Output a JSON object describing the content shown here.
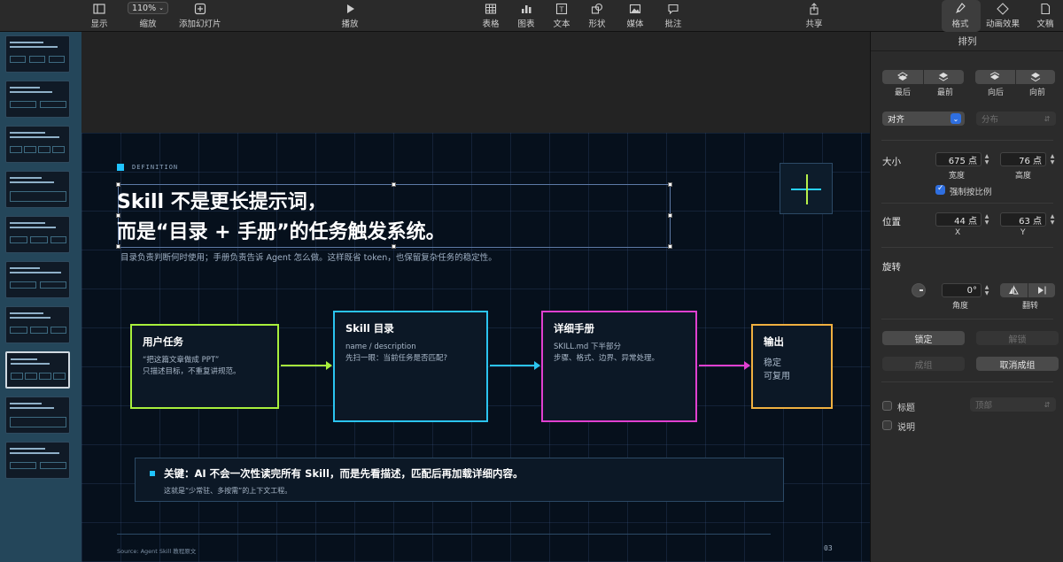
{
  "toolbar": {
    "view": "显示",
    "zoom_value": "110%",
    "zoom_label": "缩放",
    "add_slide": "添加幻灯片",
    "play": "播放",
    "table": "表格",
    "chart": "图表",
    "text": "文本",
    "shape": "形状",
    "media": "媒体",
    "comment": "批注",
    "share": "共享",
    "format": "格式",
    "animate": "动画效果",
    "document": "文稿"
  },
  "slide": {
    "tag": "DEFINITION",
    "title_line1": "Skill 不是更长提示词，",
    "title_line2": "而是“目录 + 手册”的任务触发系统。",
    "subtitle": "目录负责判断何时使用；手册负责告诉 Agent 怎么做。这样既省 token，也保留复杂任务的稳定性。",
    "flow": [
      {
        "title": "用户任务",
        "line1": "“把这篇文章做成 PPT”",
        "line2": "只描述目标，不重复讲规范。",
        "color": "#a8ef3c"
      },
      {
        "title": "Skill 目录",
        "line1": "name / description",
        "line2": "先扫一眼：当前任务是否匹配?",
        "color": "#2bc4f0"
      },
      {
        "title": "详细手册",
        "line1": "SKILL.md 下半部分",
        "line2": "步骤、格式、边界、异常处理。",
        "color": "#e040d0"
      },
      {
        "title": "输出",
        "line1": "稳定",
        "line2": "可复用",
        "color": "#f0b040"
      }
    ],
    "key_text": "关键：AI 不会一次性读完所有 Skill，而是先看描述，匹配后再加载详细内容。",
    "key_sub": "这就是“少常驻、多按需”的上下文工程。",
    "source": "Source: Agent Skill 教程原文",
    "page": "03"
  },
  "inspector": {
    "header": "排列",
    "back": "最后",
    "front": "最前",
    "backward": "向后",
    "forward": "向前",
    "align": "对齐",
    "distribute": "分布",
    "size_label": "大小",
    "width_value": "675 点",
    "width_label": "宽度",
    "height_value": "76 点",
    "height_label": "高度",
    "constrain": "强制按比例",
    "position_label": "位置",
    "x_value": "44 点",
    "x_label": "X",
    "y_value": "63 点",
    "y_label": "Y",
    "rotate_label": "旋转",
    "angle_value": "0°",
    "angle_label": "角度",
    "flip_label": "翻转",
    "lock": "锁定",
    "unlock": "解锁",
    "group": "成组",
    "ungroup": "取消成组",
    "title_check": "标题",
    "title_pos": "顶部",
    "caption_check": "说明"
  }
}
